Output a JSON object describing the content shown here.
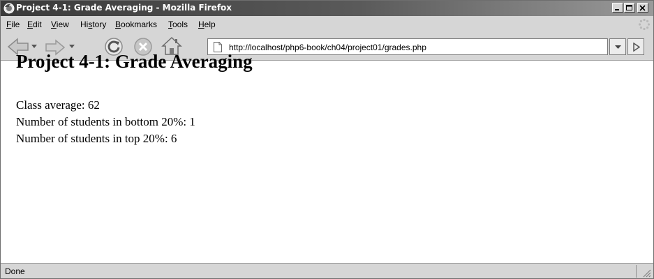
{
  "window": {
    "title": "Project 4-1: Grade Averaging - Mozilla Firefox",
    "icon": "firefox-icon"
  },
  "menubar": {
    "items": [
      {
        "label": "File",
        "accel": "F",
        "rest": "ile"
      },
      {
        "label": "Edit",
        "accel": "E",
        "rest": "dit"
      },
      {
        "label": "View",
        "accel": "V",
        "rest": "iew"
      },
      {
        "label": "History",
        "pre": "Hi",
        "accel": "s",
        "rest": "tory"
      },
      {
        "label": "Bookmarks",
        "accel": "B",
        "rest": "ookmarks"
      },
      {
        "label": "Tools",
        "accel": "T",
        "rest": "ools"
      },
      {
        "label": "Help",
        "accel": "H",
        "rest": "elp"
      }
    ]
  },
  "navbar": {
    "url": "http://localhost/php6-book/ch04/project01/grades.php"
  },
  "page": {
    "heading": "Project 4-1: Grade Averaging",
    "lines": [
      "Class average: 62",
      "Number of students in bottom 20%: 1",
      "Number of students in top 20%: 6"
    ]
  },
  "status": {
    "text": "Done"
  }
}
